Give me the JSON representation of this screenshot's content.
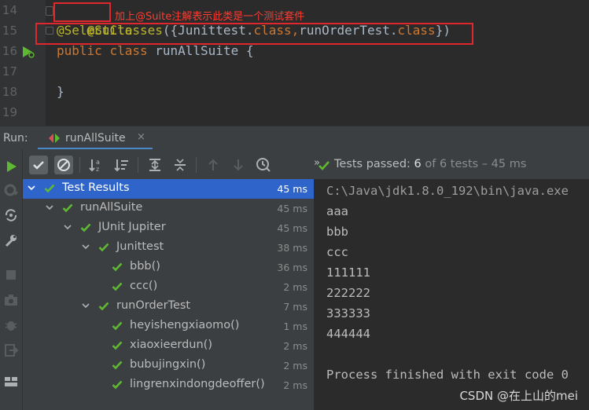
{
  "editor": {
    "line_numbers": [
      "14",
      "15",
      "16",
      "17",
      "18",
      "19"
    ],
    "line14": "@Suite",
    "line15": {
      "anno": "@SelectClasses",
      "open": "({",
      "cls1": "Junittest",
      "dot1": ".",
      "kw1": "class",
      "comma": ",",
      "cls2": "runOrderTest",
      "dot2": ".",
      "kw2": "class",
      "close": "})"
    },
    "line16": {
      "kw1": "public",
      "kw2": "class",
      "rest": " runAllSuite {"
    },
    "line18": "}",
    "annotation_note": "加上@Suite注解表示此类是一个测试套件"
  },
  "run_panel": {
    "run_label": "Run:",
    "tab_label": "runAllSuite",
    "tab_close": "×"
  },
  "status": {
    "chevrons": "»",
    "passed_label": "Tests passed: ",
    "passed_count": "6",
    "of_total": " of 6 tests – 45 ms"
  },
  "tree": [
    {
      "name": "Test Results",
      "time": "45 ms",
      "selected": true
    },
    {
      "name": "runAllSuite",
      "time": "45 ms"
    },
    {
      "name": "JUnit Jupiter",
      "time": "45 ms"
    },
    {
      "name": "Junittest",
      "time": "38 ms"
    },
    {
      "name": "bbb()",
      "time": "36 ms"
    },
    {
      "name": "ccc()",
      "time": "2 ms"
    },
    {
      "name": "runOrderTest",
      "time": "7 ms"
    },
    {
      "name": "heyishengxiaomo()",
      "time": "1 ms"
    },
    {
      "name": "xiaoxieerdun()",
      "time": "2 ms"
    },
    {
      "name": "bubujingxin()",
      "time": "2 ms"
    },
    {
      "name": "lingrenxindongdeoffer()",
      "time": "2 ms"
    }
  ],
  "console": {
    "lines": [
      "C:\\Java\\jdk1.8.0_192\\bin\\java.exe",
      "aaa",
      "bbb",
      "ccc",
      "111111",
      "222222",
      "333333",
      "444444",
      "",
      "Process finished with exit code 0"
    ]
  },
  "watermark": "CSDN @在上山的mei",
  "icons": [
    "run-icon",
    "rerun-failed-icon",
    "toggle-auto-test-icon",
    "settings-wrench-icon",
    "stop-icon",
    "camera-icon",
    "debug-bug-icon",
    "exit-icon",
    "layout-icon",
    "show-passed-check-icon",
    "show-ignored-icon",
    "sort-alpha-icon",
    "sort-duration-icon",
    "expand-all-icon",
    "collapse-all-icon",
    "prev-failed-arrow-icon",
    "next-failed-arrow-icon",
    "history-clock-icon",
    "check-icon",
    "chevron-down-icon",
    "run-gutter-icon"
  ],
  "colors": {
    "pass_green": "#5fb832",
    "selection_blue": "#2f65ca",
    "annotation_red": "#e0272d",
    "annotation_yellow": "#bbb529",
    "keyword_orange": "#cc7832"
  }
}
